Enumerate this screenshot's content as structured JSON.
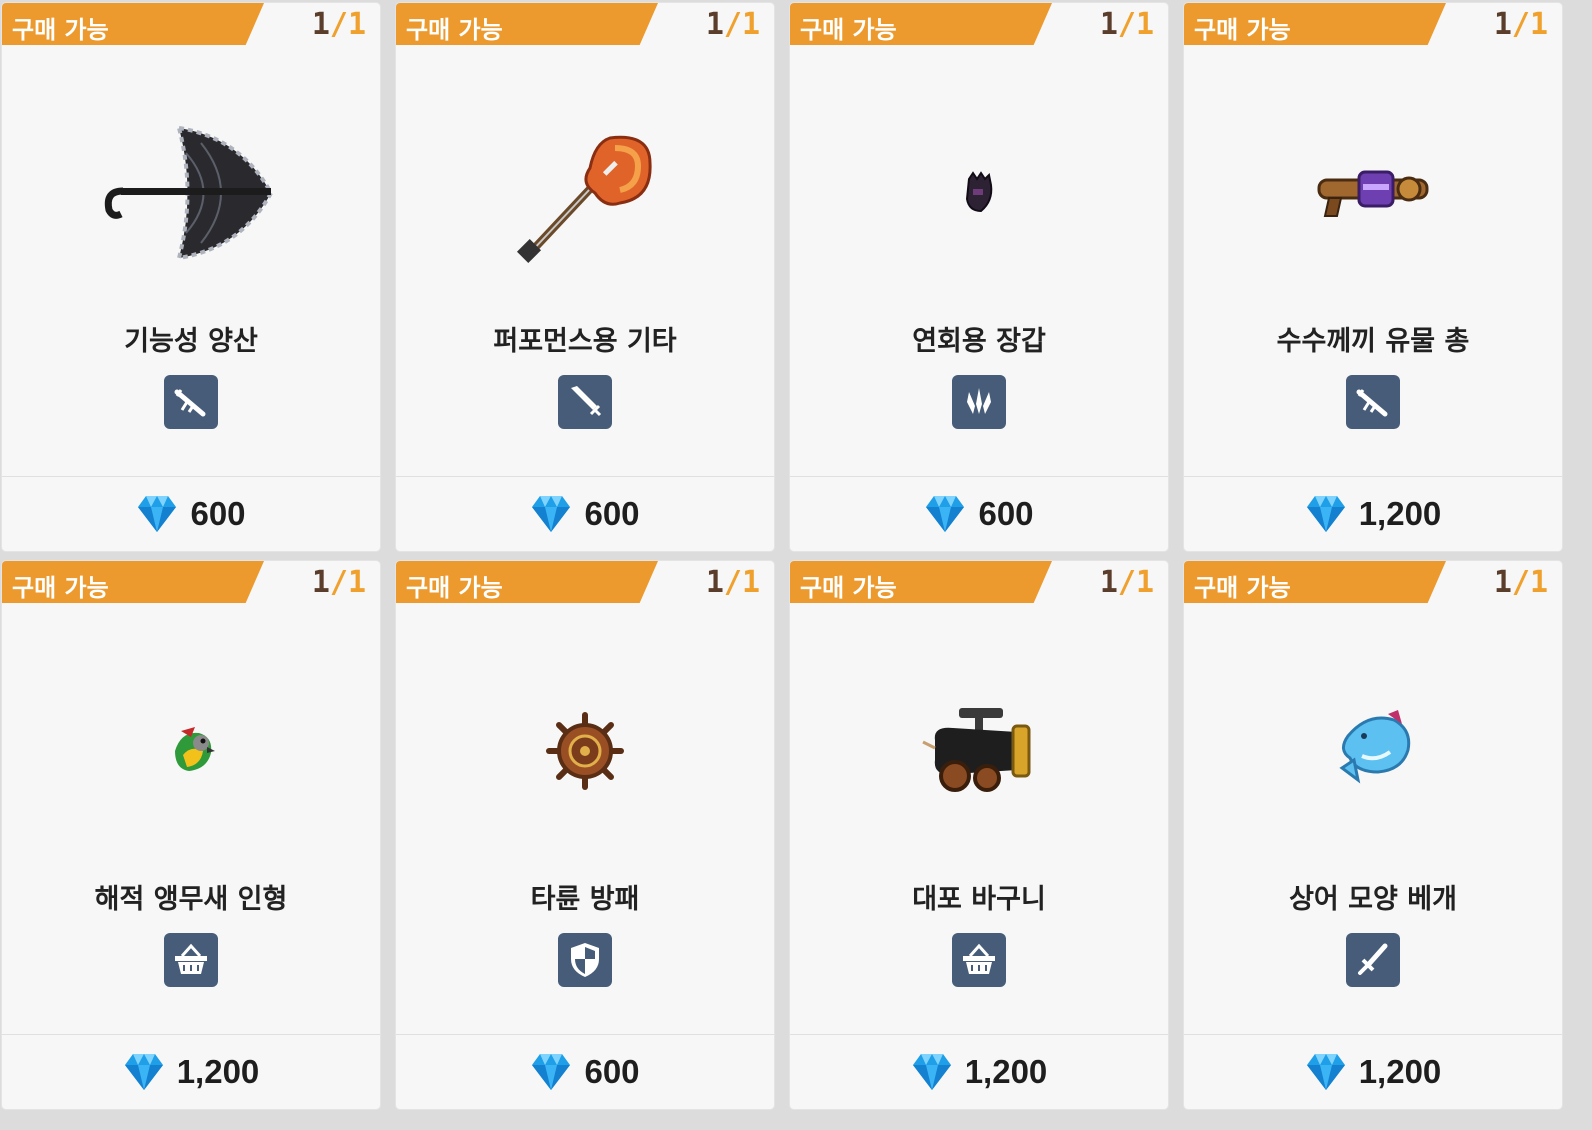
{
  "cards": [
    {
      "badge": "구매 가능",
      "current": "1",
      "separator": "/",
      "max": "1",
      "name": "기능성 양산",
      "category_icon": "rifle-icon",
      "art": "umbrella",
      "price": "600"
    },
    {
      "badge": "구매 가능",
      "current": "1",
      "separator": "/",
      "max": "1",
      "name": "퍼포먼스용 기타",
      "category_icon": "greatsword-icon",
      "art": "guitar",
      "price": "600"
    },
    {
      "badge": "구매 가능",
      "current": "1",
      "separator": "/",
      "max": "1",
      "name": "연회용 장갑",
      "category_icon": "claw-icon",
      "art": "glove",
      "price": "600"
    },
    {
      "badge": "구매 가능",
      "current": "1",
      "separator": "/",
      "max": "1",
      "name": "수수께끼 유물 총",
      "category_icon": "rifle-icon",
      "art": "relic-gun",
      "price": "1,200"
    },
    {
      "badge": "구매 가능",
      "current": "1",
      "separator": "/",
      "max": "1",
      "name": "해적 앵무새 인형",
      "category_icon": "basket-icon",
      "art": "parrot",
      "price": "1,200"
    },
    {
      "badge": "구매 가능",
      "current": "1",
      "separator": "/",
      "max": "1",
      "name": "타륜 방패",
      "category_icon": "shield-icon",
      "art": "ship-wheel",
      "price": "600"
    },
    {
      "badge": "구매 가능",
      "current": "1",
      "separator": "/",
      "max": "1",
      "name": "대포 바구니",
      "category_icon": "basket-icon",
      "art": "cannon",
      "price": "1,200"
    },
    {
      "badge": "구매 가능",
      "current": "1",
      "separator": "/",
      "max": "1",
      "name": "상어 모양 베개",
      "category_icon": "sword-icon",
      "art": "shark-pillow",
      "price": "1,200"
    }
  ],
  "colors": {
    "badge": "#ec9a2e",
    "category_bg": "#465c78",
    "count_current": "#5a3d2a",
    "count_max": "#f0a02c"
  },
  "currency_icon": "diamond-gem-icon"
}
